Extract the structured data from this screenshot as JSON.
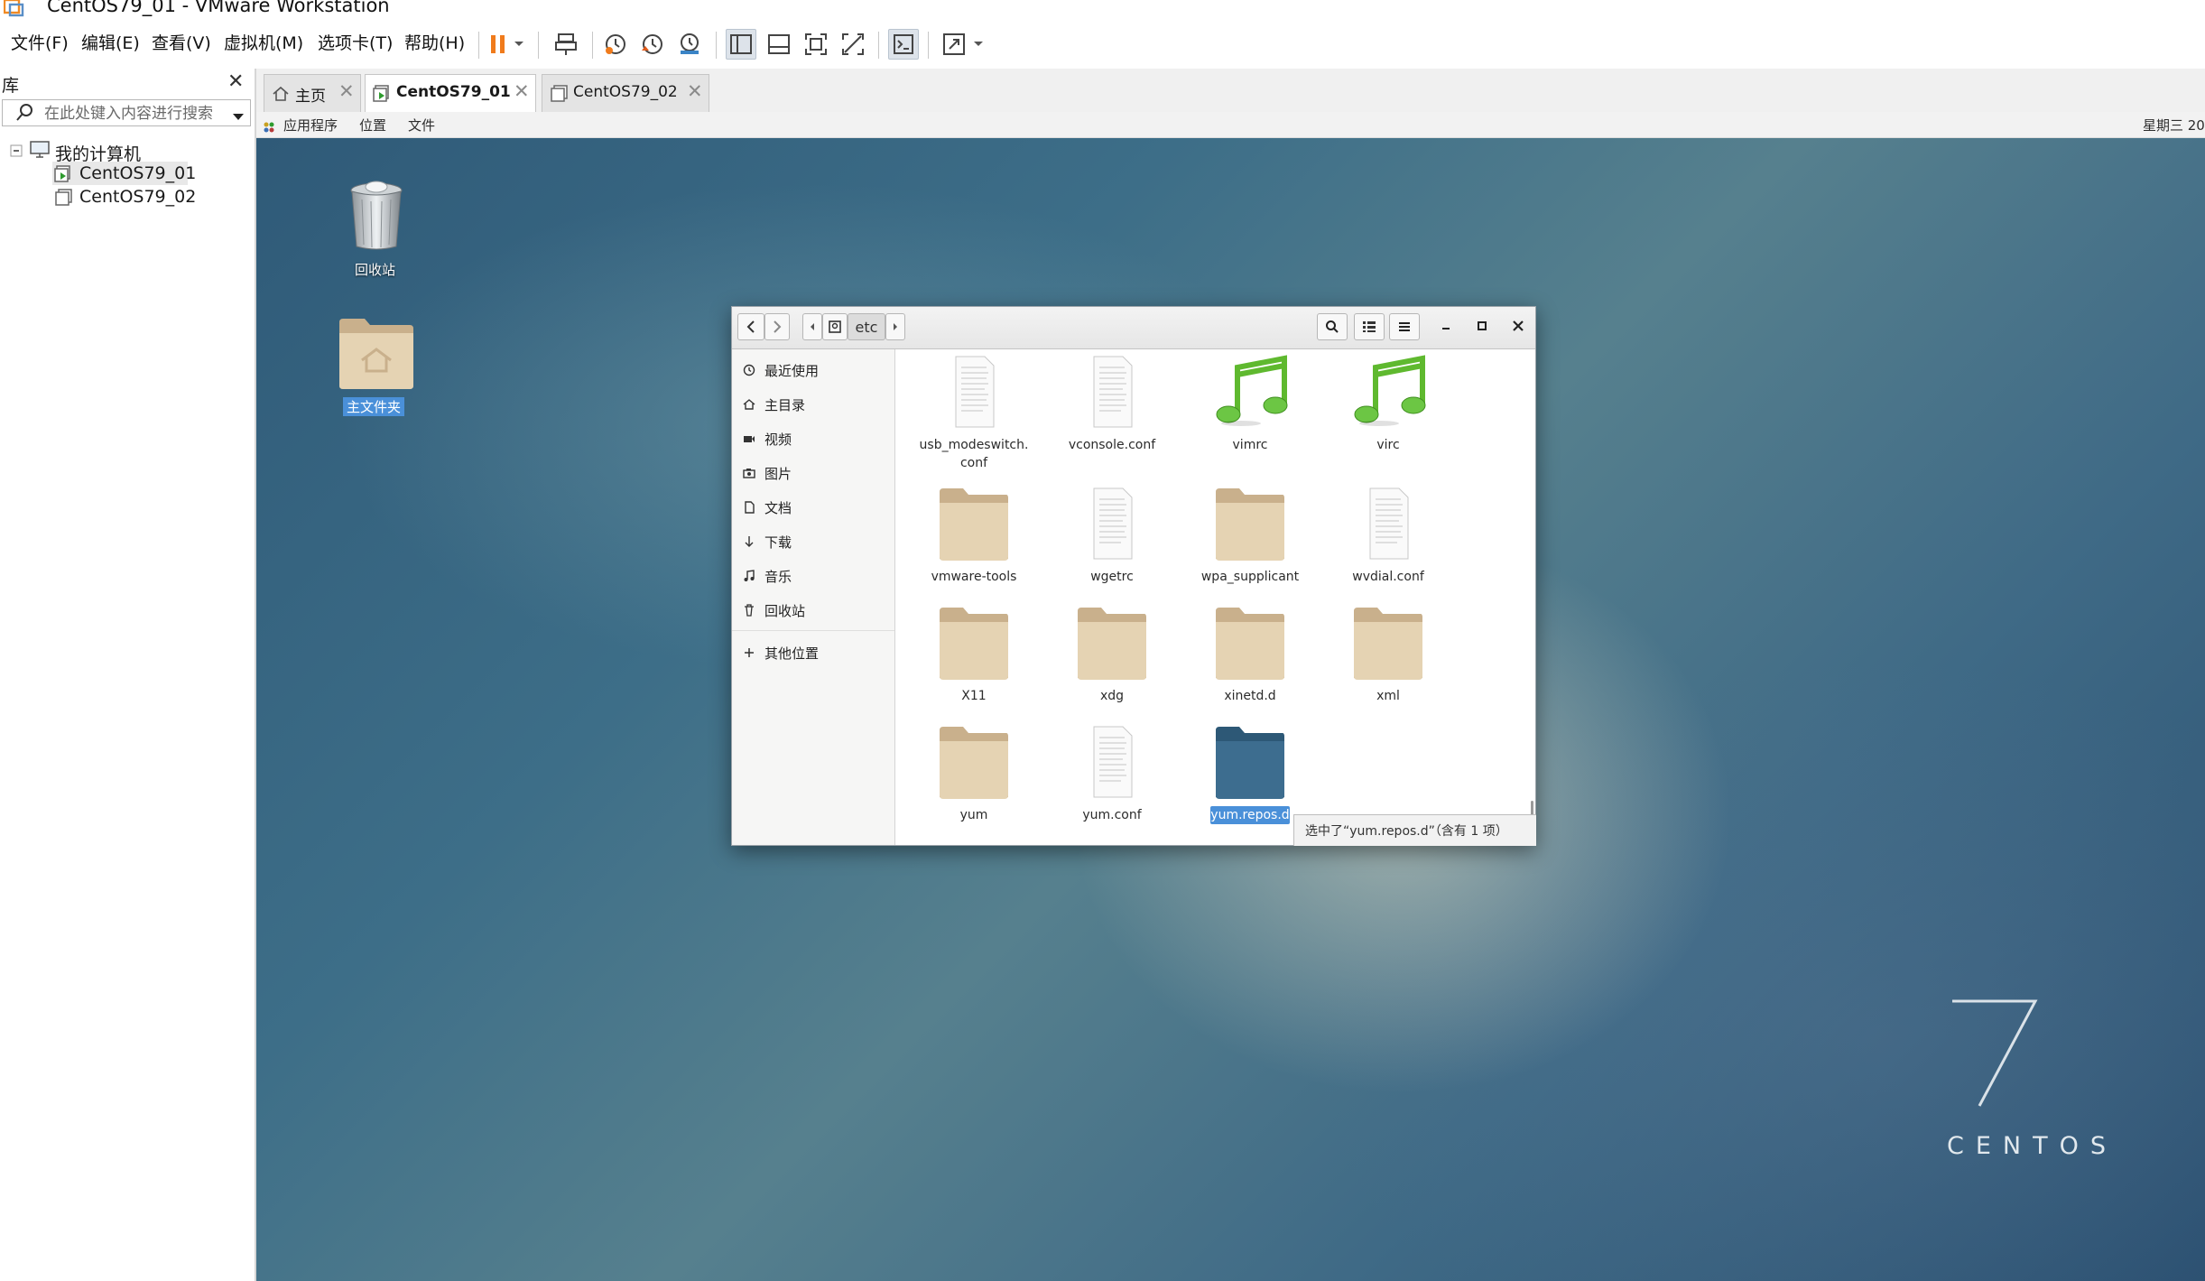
{
  "window": {
    "title": "CentOS79_01 - VMware Workstation"
  },
  "menu": {
    "items": [
      "文件(F)",
      "编辑(E)",
      "查看(V)",
      "虚拟机(M)",
      "选项卡(T)",
      "帮助(H)"
    ]
  },
  "toolbar": {
    "icons": [
      "pause-icon",
      "dropdown-arrow-icon",
      "send-ctrl-alt-del-icon",
      "snapshot-icon",
      "revert-snapshot-icon",
      "snapshot-manager-icon",
      "library-view-icon",
      "thumbnail-bar-icon",
      "full-screen-icon",
      "unity-icon",
      "console-view-icon",
      "stretch-guest-icon",
      "dropdown-arrow-icon"
    ]
  },
  "library": {
    "title": "库",
    "search_placeholder": "在此处键入内容进行搜索",
    "tree": {
      "root": "我的计算机",
      "vms": [
        "CentOS79_01",
        "CentOS79_02"
      ]
    }
  },
  "tabs": [
    {
      "label": "主页",
      "icon": "home-icon",
      "active": false
    },
    {
      "label": "CentOS79_01",
      "icon": "vm-running-icon",
      "active": true
    },
    {
      "label": "CentOS79_02",
      "icon": "vm-icon",
      "active": false
    }
  ],
  "guest_topbar": {
    "applications": "应用程序",
    "places": "位置",
    "files": "文件",
    "clock": "星期三 20"
  },
  "desktop": {
    "icons": [
      {
        "label": "回收站",
        "icon": "trash-icon"
      },
      {
        "label": "主文件夹",
        "icon": "home-folder-icon",
        "selected": true
      }
    ],
    "logo_number": "7",
    "logo_word": "CENTOS"
  },
  "file_manager": {
    "path": [
      "etc"
    ],
    "sidebar": [
      {
        "label": "最近使用",
        "icon": "recent-icon"
      },
      {
        "label": "主目录",
        "icon": "home-icon"
      },
      {
        "label": "视频",
        "icon": "video-icon"
      },
      {
        "label": "图片",
        "icon": "camera-icon"
      },
      {
        "label": "文档",
        "icon": "document-icon"
      },
      {
        "label": "下载",
        "icon": "download-icon"
      },
      {
        "label": "音乐",
        "icon": "music-icon"
      },
      {
        "label": "回收站",
        "icon": "trash-icon"
      },
      {
        "label": "其他位置",
        "icon": "plus-icon"
      }
    ],
    "files": [
      {
        "name": "usb_modeswitch.conf",
        "name_lines": [
          "usb_modeswitch.",
          "conf"
        ],
        "type": "text"
      },
      {
        "name": "vconsole.conf",
        "type": "text"
      },
      {
        "name": "vimrc",
        "type": "audio"
      },
      {
        "name": "virc",
        "type": "audio"
      },
      {
        "name": "vmware-tools",
        "type": "folder"
      },
      {
        "name": "wgetrc",
        "type": "text"
      },
      {
        "name": "wpa_supplicant",
        "type": "folder"
      },
      {
        "name": "wvdial.conf",
        "type": "text"
      },
      {
        "name": "X11",
        "type": "folder"
      },
      {
        "name": "xdg",
        "type": "folder"
      },
      {
        "name": "xinetd.d",
        "type": "folder"
      },
      {
        "name": "xml",
        "type": "folder"
      },
      {
        "name": "yum",
        "type": "folder"
      },
      {
        "name": "yum.conf",
        "type": "text"
      },
      {
        "name": "yum.repos.d",
        "type": "folder",
        "selected": true
      }
    ],
    "status": "选中了“yum.repos.d”（含有 1 项）"
  },
  "colors": {
    "folder": "#e5d3b3",
    "folder_tab": "#c9b08c",
    "selected_folder": "#3d6d8f",
    "selection": "#4a90d9",
    "music_green": "#6cc644",
    "pause_orange": "#f07b1c"
  }
}
